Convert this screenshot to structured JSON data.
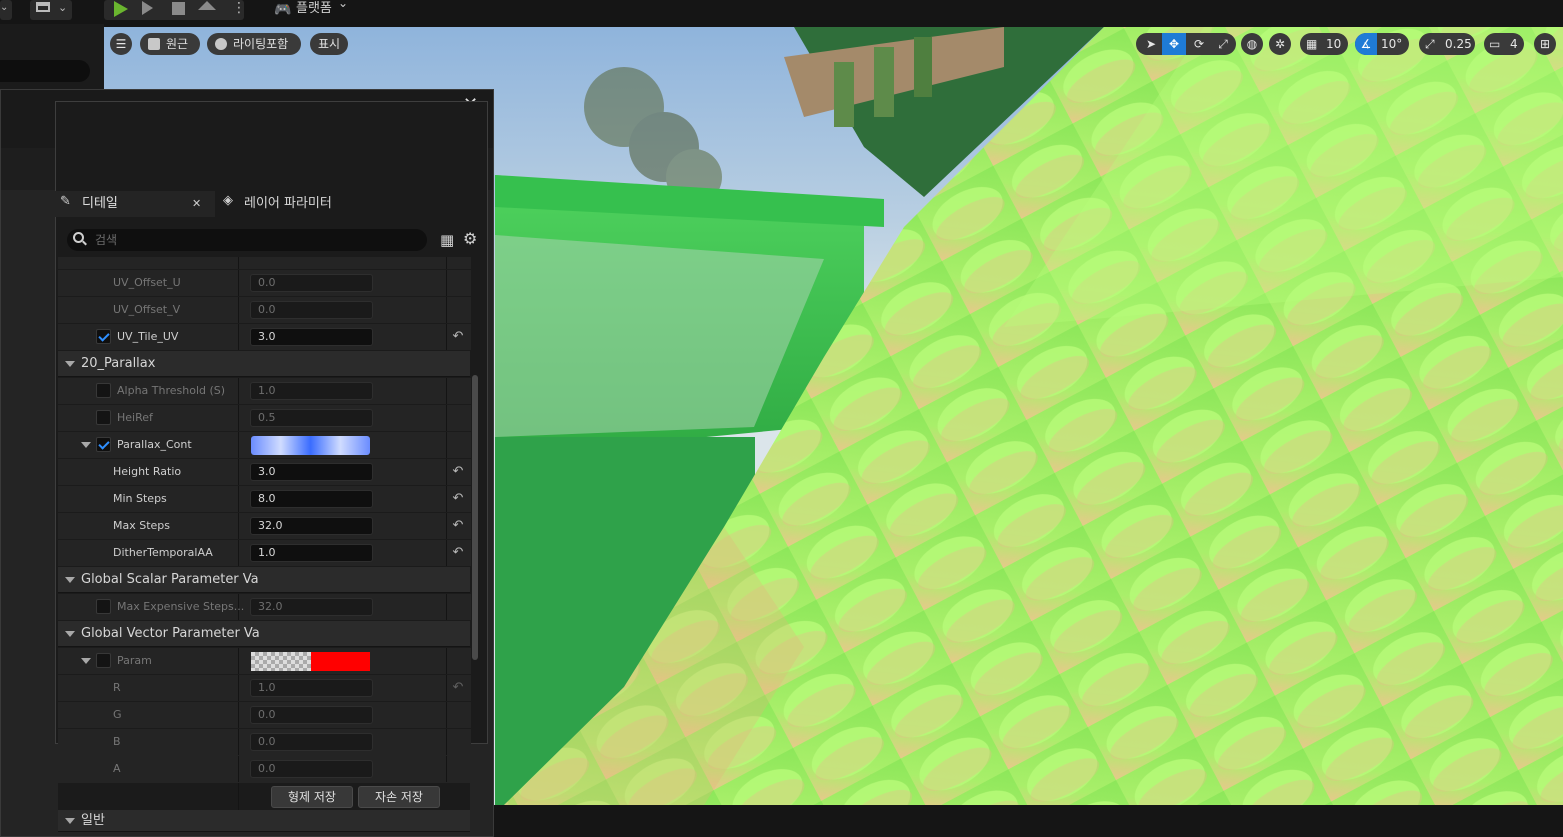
{
  "toolbar": {
    "platform_label": "플랫폼"
  },
  "viewport": {
    "perspective_label": "원근",
    "lighting_label": "라이팅포함",
    "show_label": "표시",
    "grid_snap": "10",
    "rotation_snap": "10°",
    "scale_snap": "0.25",
    "camera_speed": "4"
  },
  "details": {
    "tabs": [
      {
        "label": "디테일"
      },
      {
        "label": "레이어 파라미터"
      }
    ],
    "search_placeholder": "검색",
    "rows": [
      {
        "label": "UV_Offset_U",
        "value": "0.0"
      },
      {
        "label": "UV_Offset_V",
        "value": "0.0"
      },
      {
        "label": "UV_Tile_UV",
        "value": "3.0"
      },
      {
        "label": "20_Parallax"
      },
      {
        "label": "Alpha Threshold (S)",
        "value": "1.0"
      },
      {
        "label": "HeiRef",
        "value": "0.5"
      },
      {
        "label": "Parallax_Cont"
      },
      {
        "label": "Height Ratio",
        "value": "3.0"
      },
      {
        "label": "Min Steps",
        "value": "8.0"
      },
      {
        "label": "Max Steps",
        "value": "32.0"
      },
      {
        "label": "DitherTemporalAA",
        "value": "1.0"
      },
      {
        "label": "Global Scalar Parameter Va"
      },
      {
        "label": "Max Expensive Steps...",
        "value": "32.0"
      },
      {
        "label": "Global Vector Parameter Va"
      },
      {
        "label": "Param"
      },
      {
        "label": "R",
        "value": "1.0"
      },
      {
        "label": "G",
        "value": "0.0"
      },
      {
        "label": "B",
        "value": "0.0"
      },
      {
        "label": "A",
        "value": "0.0"
      },
      {
        "label": "일반"
      }
    ],
    "save_sibling_label": "형제 저장",
    "save_child_label": "자손 저장"
  },
  "colors": {
    "accent": "#2f8fff",
    "param_color": "#ff0000",
    "play_green": "#6ab52f"
  }
}
